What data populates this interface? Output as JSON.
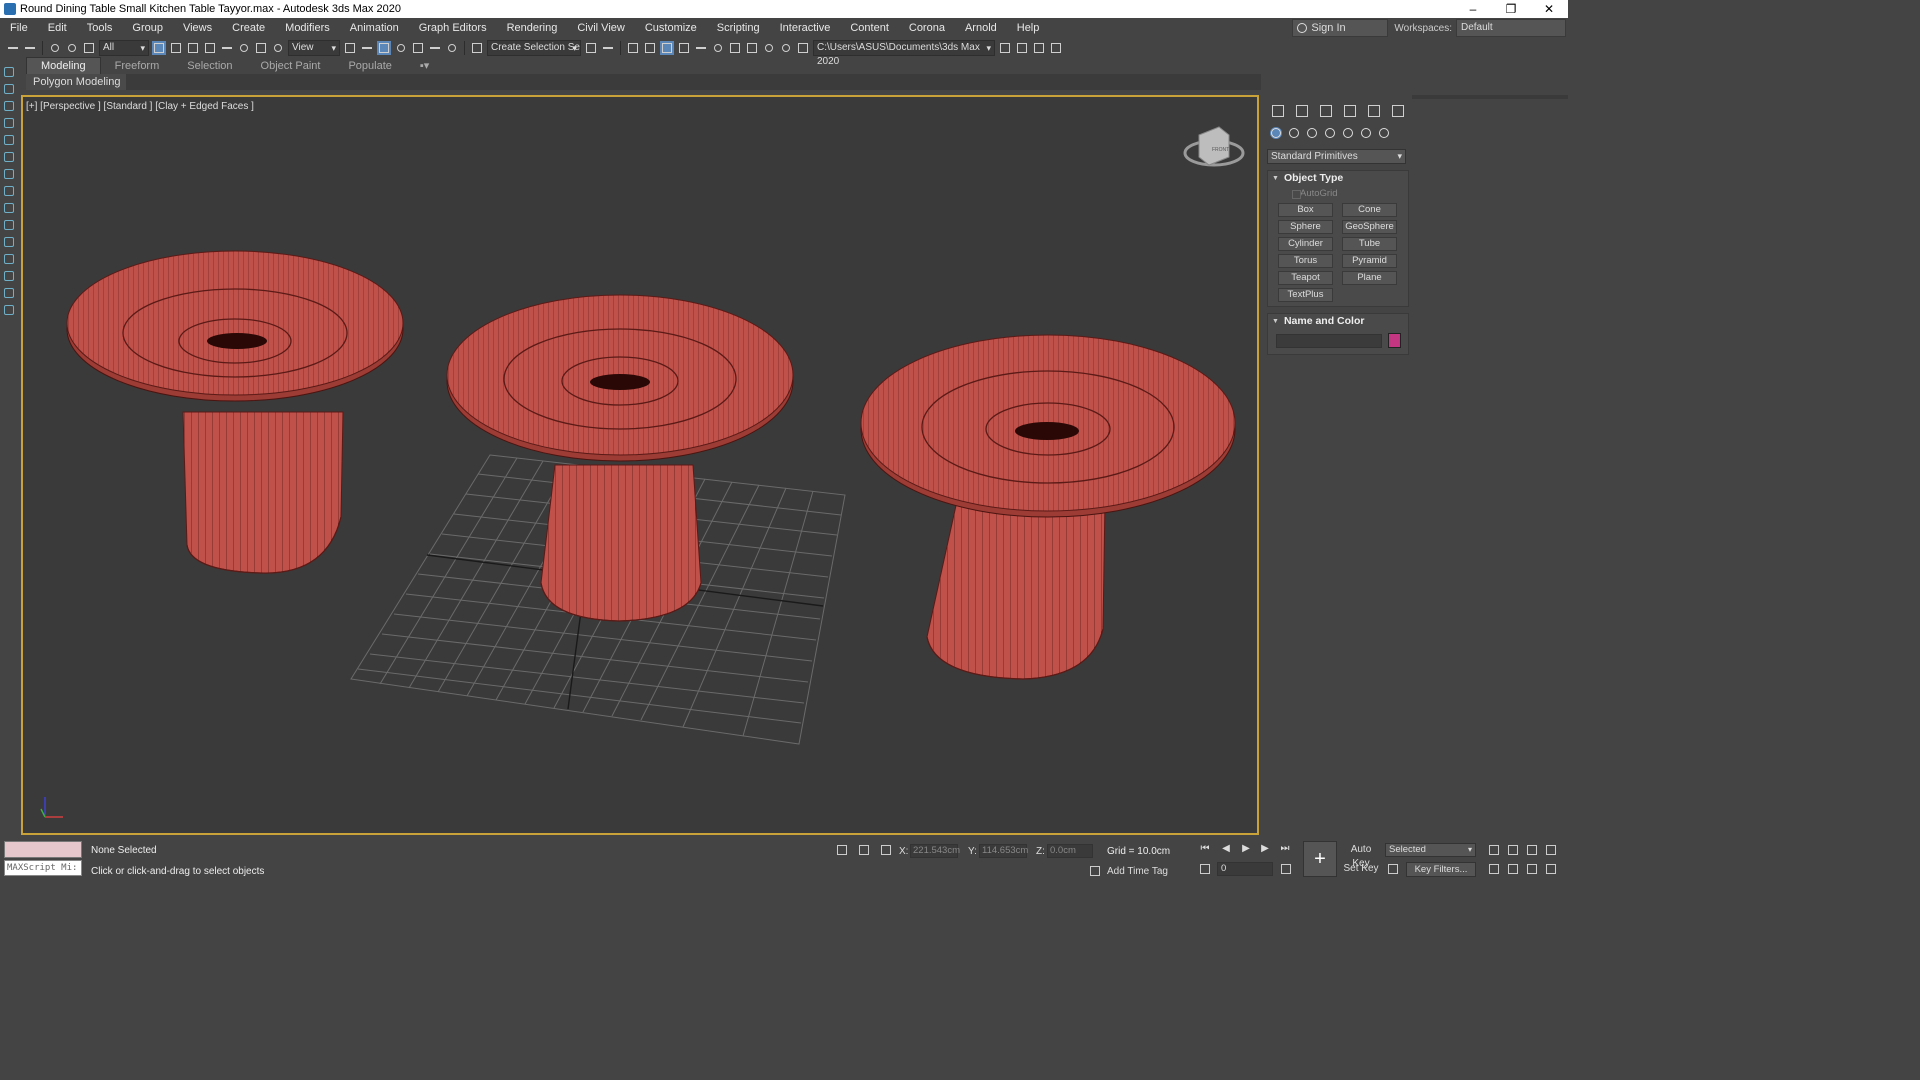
{
  "window": {
    "title": "Round Dining Table Small Kitchen Table Tayyor.max - Autodesk 3ds Max 2020",
    "controls": [
      "–",
      "❐",
      "✕"
    ]
  },
  "menu": [
    "File",
    "Edit",
    "Tools",
    "Group",
    "Views",
    "Create",
    "Modifiers",
    "Animation",
    "Graph Editors",
    "Rendering",
    "Civil View",
    "Customize",
    "Scripting",
    "Interactive",
    "Content",
    "Corona",
    "Arnold",
    "Help"
  ],
  "account": {
    "sign_in": "Sign In",
    "workspaces_label": "Workspaces:",
    "workspace": "Default"
  },
  "toolbar": {
    "filter": "All",
    "coord_system": "View",
    "selection_set": "Create Selection Se",
    "project_path": "C:\\Users\\ASUS\\Documents\\3ds Max 2020"
  },
  "ribbon": {
    "tabs": [
      "Modeling",
      "Freeform",
      "Selection",
      "Object Paint",
      "Populate"
    ],
    "active_tab": "Modeling",
    "sub_label": "Polygon Modeling"
  },
  "viewport": {
    "label": "[+] [Perspective ] [Standard ] [Clay + Edged Faces ]",
    "object_color": "#c0504a",
    "edge_color": "#5a1a16",
    "viewcube_label": "FRONT"
  },
  "command_panel": {
    "category_dropdown": "Standard Primitives",
    "object_type_title": "Object Type",
    "autogrid_label": "AutoGrid",
    "buttons": [
      "Box",
      "Cone",
      "Sphere",
      "GeoSphere",
      "Cylinder",
      "Tube",
      "Torus",
      "Pyramid",
      "Teapot",
      "Plane",
      "TextPlus"
    ],
    "name_color_title": "Name and Color",
    "object_color_swatch": "#c43582"
  },
  "status": {
    "maxscript_placeholder": "MAXScript Mi:",
    "selection_status": "None Selected",
    "prompt": "Click or click-and-drag to select objects",
    "x_label": "X:",
    "x_value": "221.543cm",
    "y_label": "Y:",
    "y_value": "114.653cm",
    "z_label": "Z:",
    "z_value": "0.0cm",
    "grid": "Grid = 10.0cm",
    "add_time_tag": "Add Time Tag",
    "frame": "0",
    "auto_key": "Auto Key",
    "set_key": "Set Key",
    "key_mode": "Selected",
    "key_filters": "Key Filters..."
  }
}
